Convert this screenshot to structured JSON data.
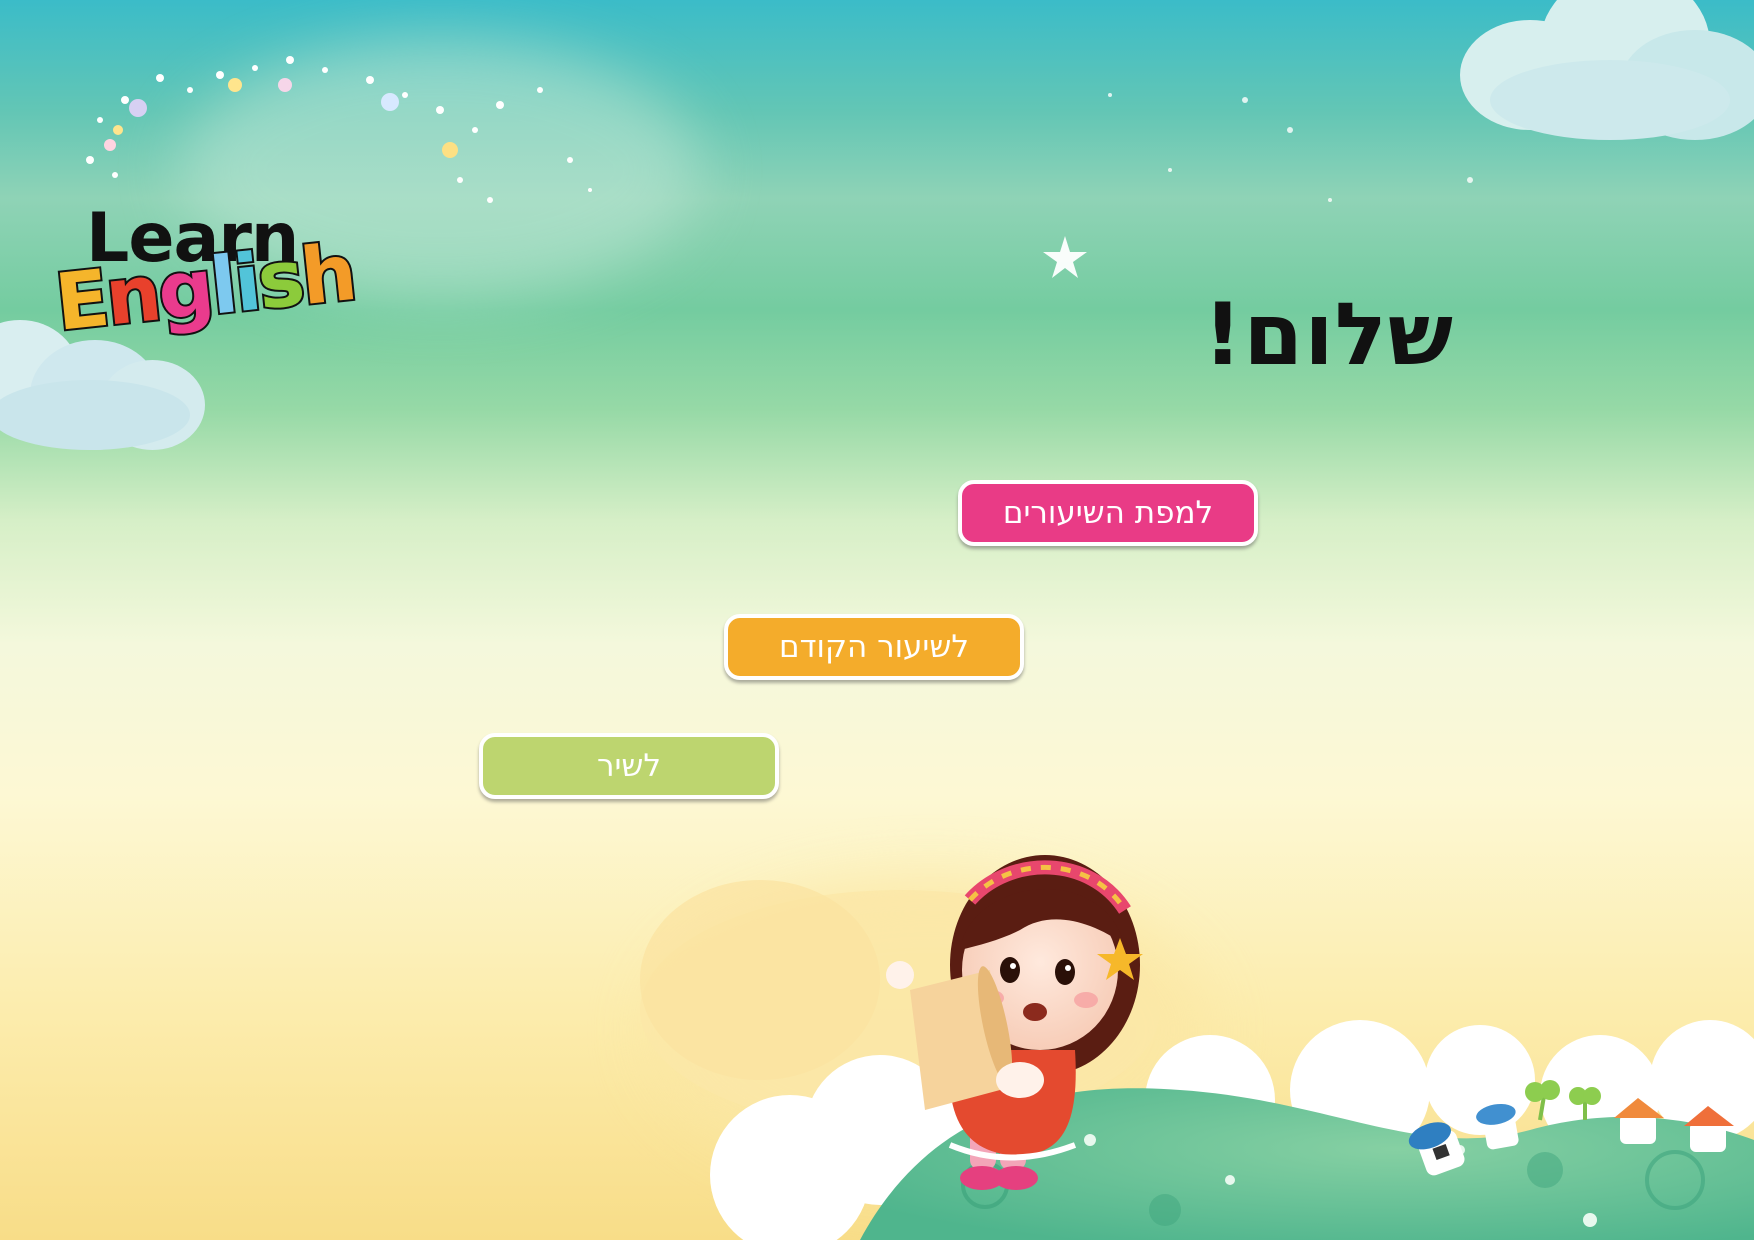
{
  "logo": {
    "line1": "Learn",
    "line2": "English"
  },
  "greeting": "שלום!",
  "buttons": {
    "lessons_map": "למפת השיעורים",
    "previous_lesson": "לשיעור הקודם",
    "song": "לשיר"
  },
  "colors": {
    "pink_button": "#e93b86",
    "orange_button": "#f4ac2b",
    "green_button": "#bdd56f"
  }
}
